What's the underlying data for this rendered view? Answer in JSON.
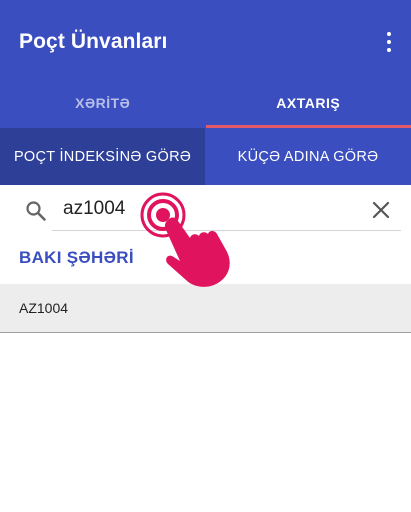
{
  "app": {
    "title": "Poçt Ünvanları",
    "menu_icon": "more-vert-icon"
  },
  "tabs": [
    {
      "label": "XƏRİTƏ",
      "active": false
    },
    {
      "label": "AXTARIŞ",
      "active": true
    }
  ],
  "subtabs": [
    {
      "label": "POÇT İNDEKSİNƏ GÖRƏ",
      "active": true
    },
    {
      "label": "KÜÇƏ ADINA GÖRƏ",
      "active": false
    }
  ],
  "search": {
    "value": "az1004",
    "icon": "search-icon",
    "clear_icon": "close-icon"
  },
  "results": {
    "city": "BAKI ŞƏHƏRİ",
    "items": [
      {
        "code": "AZ1004"
      }
    ]
  },
  "colors": {
    "primary": "#3a4ec0",
    "primary_dark": "#2e3f98",
    "tab_indicator": "#e25b6a",
    "tap_hand": "#e0145e"
  }
}
